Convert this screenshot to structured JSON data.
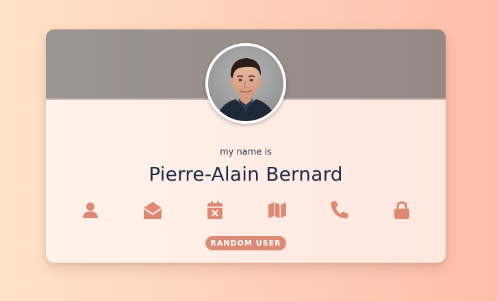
{
  "colors": {
    "background_left": "#ffe3c9",
    "background_right": "#fdbea9",
    "header_left": "#9c9592",
    "header_right": "#958884",
    "body_left": "#fff2ea",
    "body_right": "#fde7e0",
    "accent": "#dc8a75"
  },
  "profile": {
    "label": "my name is",
    "value": "Pierre-Alain Bernard"
  },
  "icons": [
    {
      "name": "user-icon",
      "kind": "user"
    },
    {
      "name": "envelope-open-icon",
      "kind": "envelope-open"
    },
    {
      "name": "calendar-x-icon",
      "kind": "calendar-x"
    },
    {
      "name": "map-icon",
      "kind": "map"
    },
    {
      "name": "phone-icon",
      "kind": "phone"
    },
    {
      "name": "lock-icon",
      "kind": "lock"
    }
  ],
  "actions": {
    "random_label": "RANDOM USER"
  }
}
